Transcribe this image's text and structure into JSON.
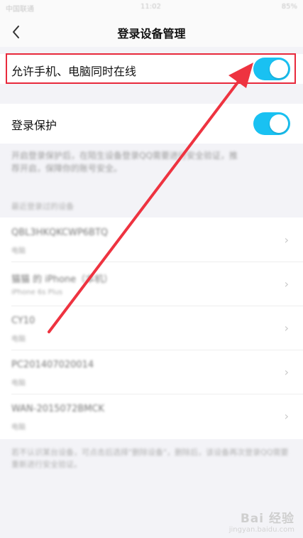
{
  "status_bar": {
    "left": "中国联通",
    "time": "11:02",
    "right": "85%"
  },
  "nav": {
    "title": "登录设备管理"
  },
  "settings": {
    "simultaneous_online": {
      "label": "允许手机、电脑同时在线",
      "enabled": true
    },
    "login_protection": {
      "label": "登录保护",
      "enabled": true
    },
    "protection_desc_line1": "开启登录保护后，在陌生设备登录QQ需要进行安全验证，",
    "protection_desc_line1_tail": "推",
    "protection_desc_line2": "荐开启，保障你的账号安全。"
  },
  "device_section_header": "最近登录过的设备",
  "devices": [
    {
      "name": "QBL3HKQKCWP6BTQ",
      "sub": "电脑"
    },
    {
      "name": "猫猫 的 iPhone（本机）",
      "sub": "iPhone 6s Plus"
    },
    {
      "name": "CY10",
      "sub": "电脑"
    },
    {
      "name": "PC201407020014",
      "sub": "电脑"
    },
    {
      "name": "WAN-2015072BMCK",
      "sub": "电脑"
    }
  ],
  "footer_note": "若不认识某台设备，可点击后选择\"删除设备\"，删除后，该设备再次登录QQ需要重新进行安全验证。",
  "watermark": {
    "main": "Bai 经验",
    "sub": "jingyan.baidu.com"
  },
  "colors": {
    "toggle_on": "#19c1f2",
    "highlight": "#e8293c",
    "arrow": "#ee3340"
  }
}
